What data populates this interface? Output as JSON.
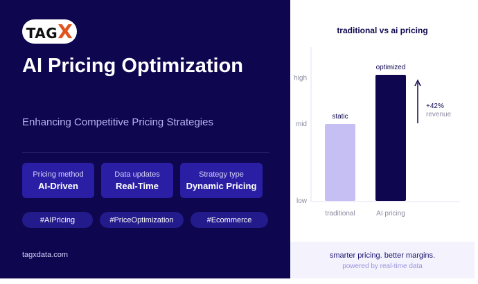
{
  "brand": {
    "logo_text": "TAG",
    "logo_x": "X",
    "website": "tagxdata.com"
  },
  "hero": {
    "title": "AI Pricing Optimization",
    "subtitle": "Enhancing Competitive Pricing Strategies"
  },
  "stats": [
    {
      "label": "Pricing method",
      "value": "AI-Driven"
    },
    {
      "label": "Data updates",
      "value": "Real-Time"
    },
    {
      "label": "Strategy type",
      "value": "Dynamic Pricing"
    }
  ],
  "tags": [
    "#AIPricing",
    "#PriceOptimization",
    "#Ecommerce"
  ],
  "chart_data": {
    "type": "bar",
    "title": "traditional vs ai pricing",
    "categories": [
      "traditional",
      "AI pricing"
    ],
    "values": [
      0.5,
      0.82
    ],
    "bar_labels": [
      "static",
      "optimized"
    ],
    "y_ticks": [
      {
        "value": 0,
        "label": "low"
      },
      {
        "value": 0.5,
        "label": "mid"
      },
      {
        "value": 0.8,
        "label": "high"
      }
    ],
    "ylim": [
      0,
      1
    ],
    "colors": [
      "#c5bff4",
      "#0e0750"
    ],
    "annotation": {
      "value": "+42%",
      "text": "revenue"
    }
  },
  "footer": {
    "tagline": "smarter pricing. better margins.",
    "powered": "powered by real-time data"
  },
  "colors": {
    "panel": "#0e0750",
    "card": "#2a1fa4",
    "tag": "#231a8c",
    "accent": "#e0531c"
  }
}
